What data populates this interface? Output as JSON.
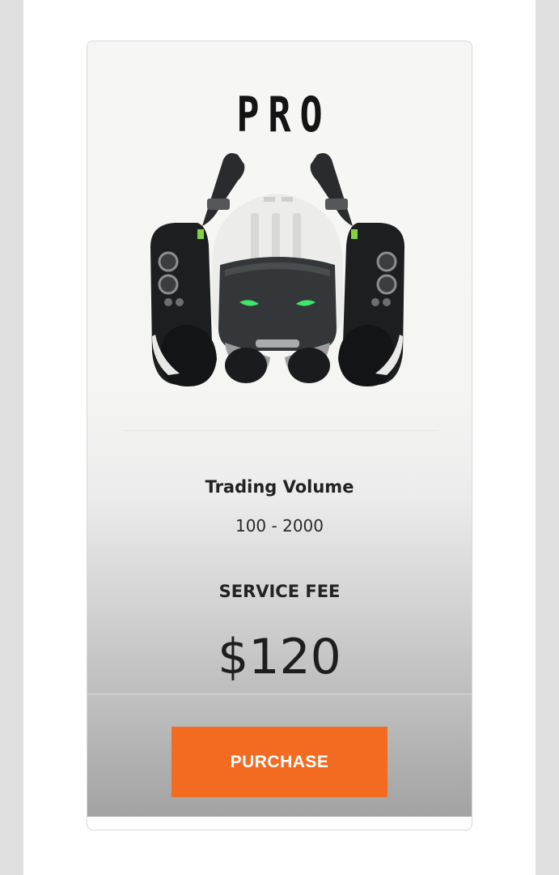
{
  "plan": {
    "title": "PRO",
    "image_icon": "robot-icon",
    "trading_volume_label": "Trading Volume",
    "trading_volume_value": "100 - 2000",
    "service_fee_label": "SERVICE FEE",
    "service_fee_value": "$120",
    "purchase_label": "PURCHASE"
  },
  "colors": {
    "accent": "#f26b21",
    "robot_eye": "#3ee66a"
  }
}
